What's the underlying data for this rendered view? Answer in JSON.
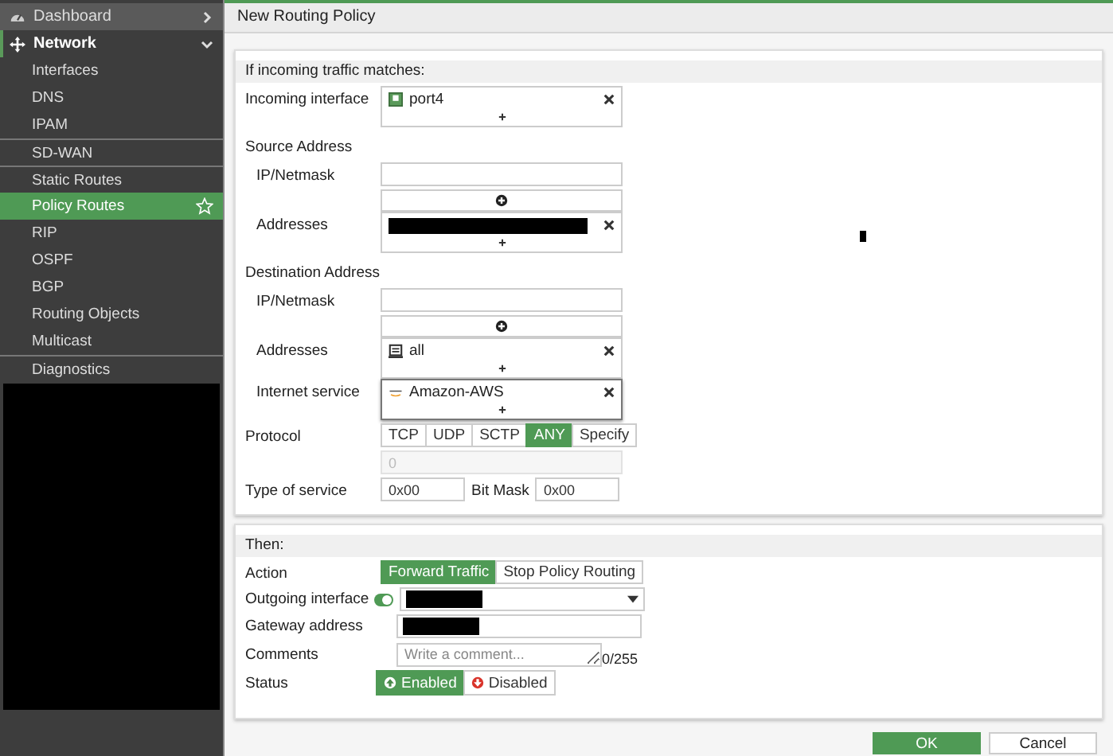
{
  "sidebar": {
    "items": [
      {
        "label": "Dashboard",
        "expanded": false
      },
      {
        "label": "Network",
        "expanded": true,
        "children": [
          {
            "label": "Interfaces",
            "selected": false,
            "separator": false
          },
          {
            "label": "DNS",
            "selected": false,
            "separator": false
          },
          {
            "label": "IPAM",
            "selected": false,
            "separator": false
          },
          {
            "label": "SD-WAN",
            "selected": false,
            "separator": true
          },
          {
            "label": "Static Routes",
            "selected": false,
            "separator": true
          },
          {
            "label": "Policy Routes",
            "selected": true,
            "separator": false
          },
          {
            "label": "RIP",
            "selected": false,
            "separator": false
          },
          {
            "label": "OSPF",
            "selected": false,
            "separator": false
          },
          {
            "label": "BGP",
            "selected": false,
            "separator": false
          },
          {
            "label": "Routing Objects",
            "selected": false,
            "separator": false
          },
          {
            "label": "Multicast",
            "selected": false,
            "separator": false
          },
          {
            "label": "Diagnostics",
            "selected": false,
            "separator": true
          }
        ]
      }
    ]
  },
  "page_title": "New Routing Policy",
  "sections": [
    {
      "title": "If incoming traffic matches:",
      "rows": [
        {
          "kind": "picker",
          "label": "Incoming interface",
          "focused": false,
          "entries": [
            {
              "kind": "port",
              "text": "port4"
            }
          ]
        },
        {
          "kind": "group",
          "label": "Source Address",
          "children": [
            {
              "kind": "ip",
              "label": "IP/Netmask"
            },
            {
              "kind": "picker",
              "label": "Addresses",
              "focused": false,
              "entries": [
                {
                  "kind": "redacted"
                }
              ]
            }
          ]
        },
        {
          "kind": "group",
          "label": "Destination Address",
          "children": [
            {
              "kind": "ip",
              "label": "IP/Netmask"
            },
            {
              "kind": "picker",
              "label": "Addresses",
              "focused": false,
              "entries": [
                {
                  "kind": "address",
                  "text": "all"
                }
              ]
            },
            {
              "kind": "picker",
              "label": "Internet service",
              "focused": true,
              "entries": [
                {
                  "kind": "service",
                  "text": "Amazon-AWS"
                }
              ]
            }
          ]
        },
        {
          "kind": "segmented",
          "label": "Protocol",
          "options": [
            {
              "label": "TCP",
              "selected": false
            },
            {
              "label": "UDP",
              "selected": false
            },
            {
              "label": "SCTP",
              "selected": false
            },
            {
              "label": "ANY",
              "selected": true
            },
            {
              "label": "Specify",
              "selected": false
            }
          ]
        },
        {
          "kind": "number",
          "placeholder": "0",
          "disabled": true
        },
        {
          "kind": "tos",
          "label": "Type of service",
          "value": "0x00",
          "mask_label": "Bit Mask",
          "mask_value": "0x00"
        }
      ]
    },
    {
      "title": "Then:",
      "rows": [
        {
          "kind": "segmented",
          "label": "Action",
          "options": [
            {
              "label": "Forward Traffic",
              "selected": true
            },
            {
              "label": "Stop Policy Routing",
              "selected": false
            }
          ]
        },
        {
          "kind": "select",
          "label": "Outgoing interface",
          "on": true
        },
        {
          "kind": "redacted_field",
          "label": "Gateway address"
        },
        {
          "kind": "textarea",
          "label": "Comments",
          "placeholder": "Write a comment...",
          "counter": "0/255"
        },
        {
          "kind": "status",
          "label": "Status",
          "options": [
            {
              "label": "Enabled",
              "selected": true
            },
            {
              "label": "Disabled",
              "selected": false
            }
          ]
        }
      ]
    }
  ],
  "buttons": [
    {
      "label": "OK",
      "kind": "primary"
    },
    {
      "label": "Cancel",
      "kind": "secondary"
    }
  ]
}
